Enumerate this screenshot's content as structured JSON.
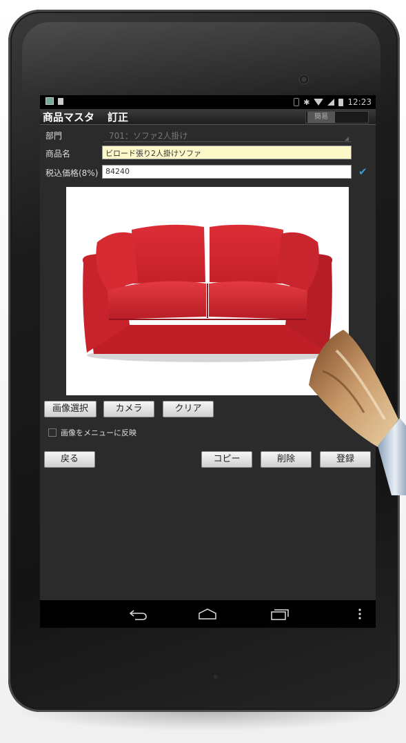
{
  "status_bar": {
    "time": "12:23",
    "bluetooth": "✱"
  },
  "title_bar": {
    "title": "商品マスタ",
    "subtitle": "訂正",
    "mode": "簡易"
  },
  "form": {
    "department_label": "部門",
    "department_value": "701：ソファ2人掛け",
    "name_label": "商品名",
    "name_value": "ビロード張り2人掛けソファ",
    "price_label": "税込価格(8%)",
    "price_value": "84240",
    "tax_checked": true
  },
  "image_buttons": {
    "select": "画像選択",
    "camera": "カメラ",
    "clear": "クリア"
  },
  "menu_option": {
    "label": "画像をメニューに反映",
    "checked": false
  },
  "action_buttons": {
    "back": "戻る",
    "copy": "コピー",
    "delete": "削除",
    "register": "登録"
  },
  "colors": {
    "sofa": "#d8262f",
    "name_field_bg": "#fdf8c8",
    "check_blue": "#3a9bd8",
    "screen_bg": "#2b2b2b"
  },
  "icons": {
    "back": "back-arrow-icon",
    "home": "home-icon",
    "recents": "recent-apps-icon",
    "menu": "overflow-menu-icon"
  }
}
